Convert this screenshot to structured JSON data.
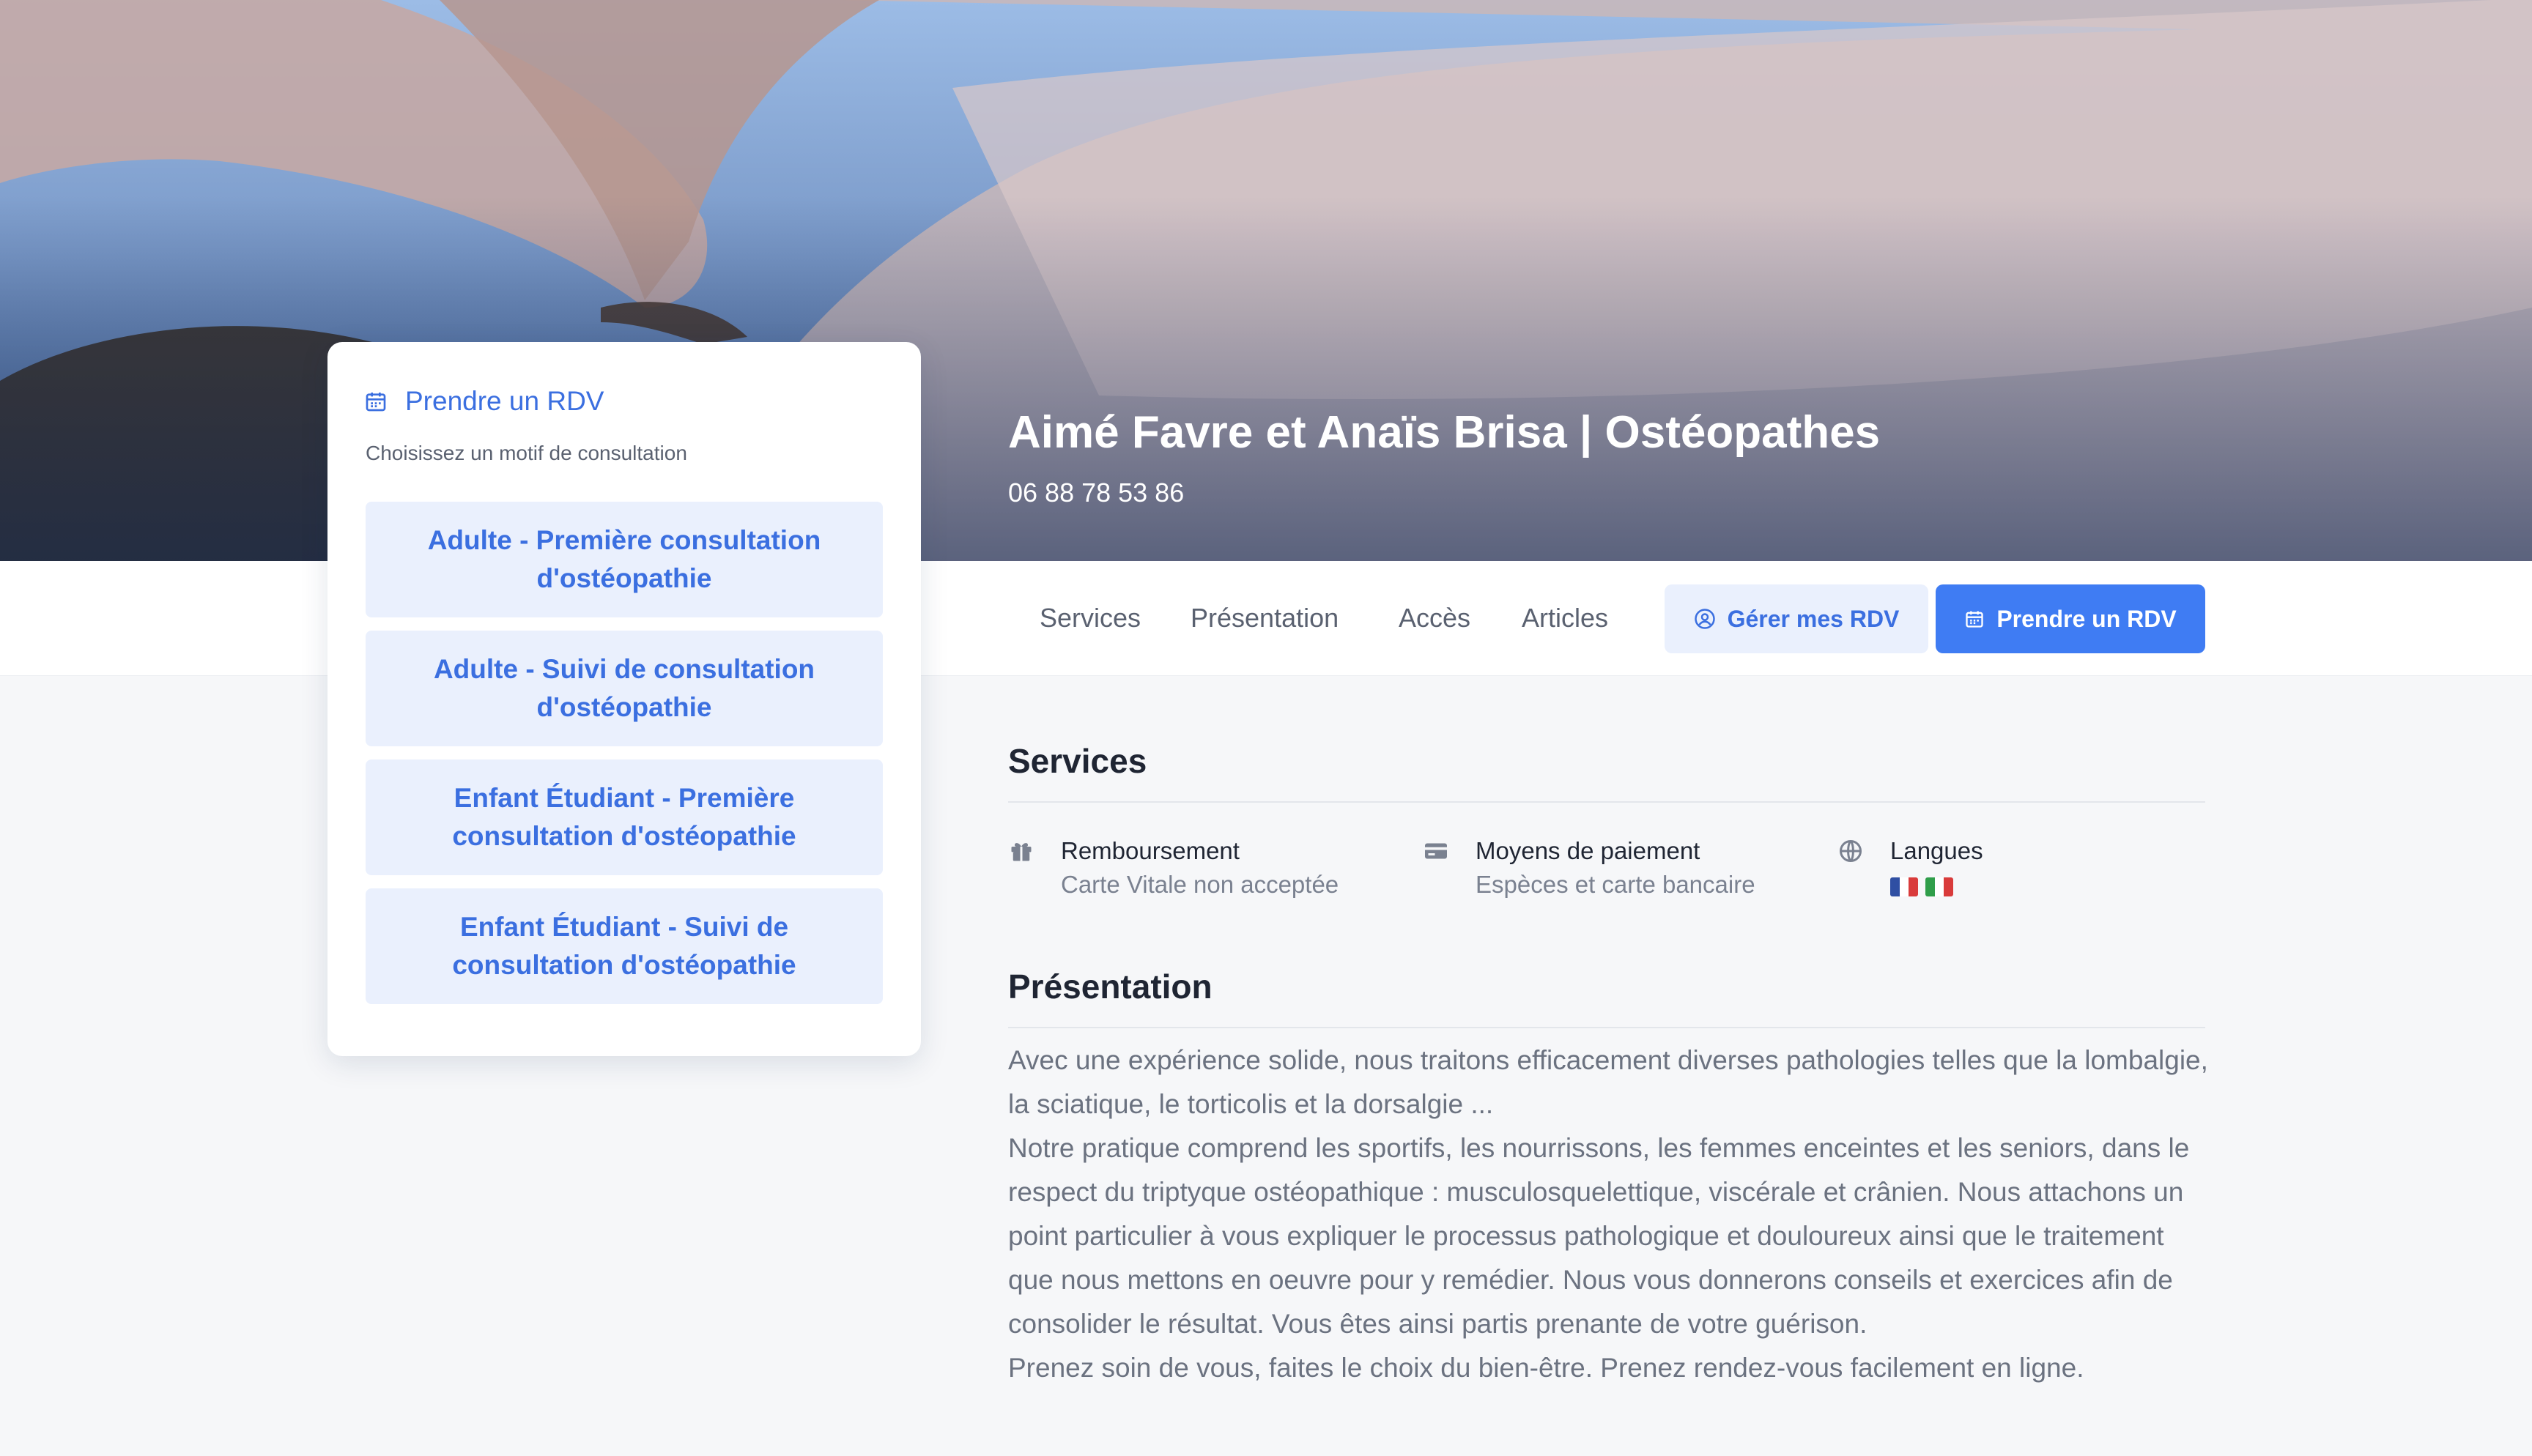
{
  "header": {
    "title": "Aimé Favre et Anaïs Brisa | Ostéopathes",
    "phone": "06 88 78 53 86"
  },
  "nav": {
    "links": [
      "Services",
      "Présentation",
      "Accès",
      "Articles"
    ],
    "manage_label": "Gérer mes RDV",
    "book_label": "Prendre un RDV"
  },
  "booking": {
    "title": "Prendre un RDV",
    "subtitle": "Choisissez un motif de consultation",
    "motifs": [
      "Adulte - Première consultation d'ostéopathie",
      "Adulte - Suivi de consultation d'ostéopathie",
      "Enfant Étudiant - Première consultation d'ostéopathie",
      "Enfant Étudiant - Suivi de consultation d'ostéopathie"
    ]
  },
  "services": {
    "title": "Services",
    "items": [
      {
        "icon": "gift-icon",
        "label": "Remboursement",
        "value": "Carte Vitale non acceptée"
      },
      {
        "icon": "credit-card-icon",
        "label": "Moyens de paiement",
        "value": "Espèces et carte bancaire"
      },
      {
        "icon": "globe-icon",
        "label": "Langues",
        "value": ""
      }
    ],
    "flags": [
      "french-flag-icon",
      "italian-flag-icon"
    ]
  },
  "presentation": {
    "title": "Présentation",
    "lines": [
      "Avec une expérience solide, nous traitons efficacement diverses pathologies telles que la lombalgie, la sciatique, le torticolis et la dorsalgie ...",
      "Notre pratique comprend les sportifs, les nourrissons, les femmes enceintes et les seniors, dans le respect du triptyque ostéopathique : musculosquelettique, viscérale et crânien. Nous attachons un point particulier à vous expliquer le processus pathologique et douloureux ainsi que le traitement que nous mettons en oeuvre pour y remédier. Nous vous donnerons conseils et exercices afin de consolider le résultat. Vous êtes ainsi partis prenante de votre guérison.",
      "Prenez soin de vous, faites le choix du bien-être. Prenez rendez-vous facilement en ligne."
    ]
  },
  "colors": {
    "accent": "#3f7cf3",
    "accent_text": "#3b6fe0",
    "accent_light": "#eaf0fd"
  }
}
